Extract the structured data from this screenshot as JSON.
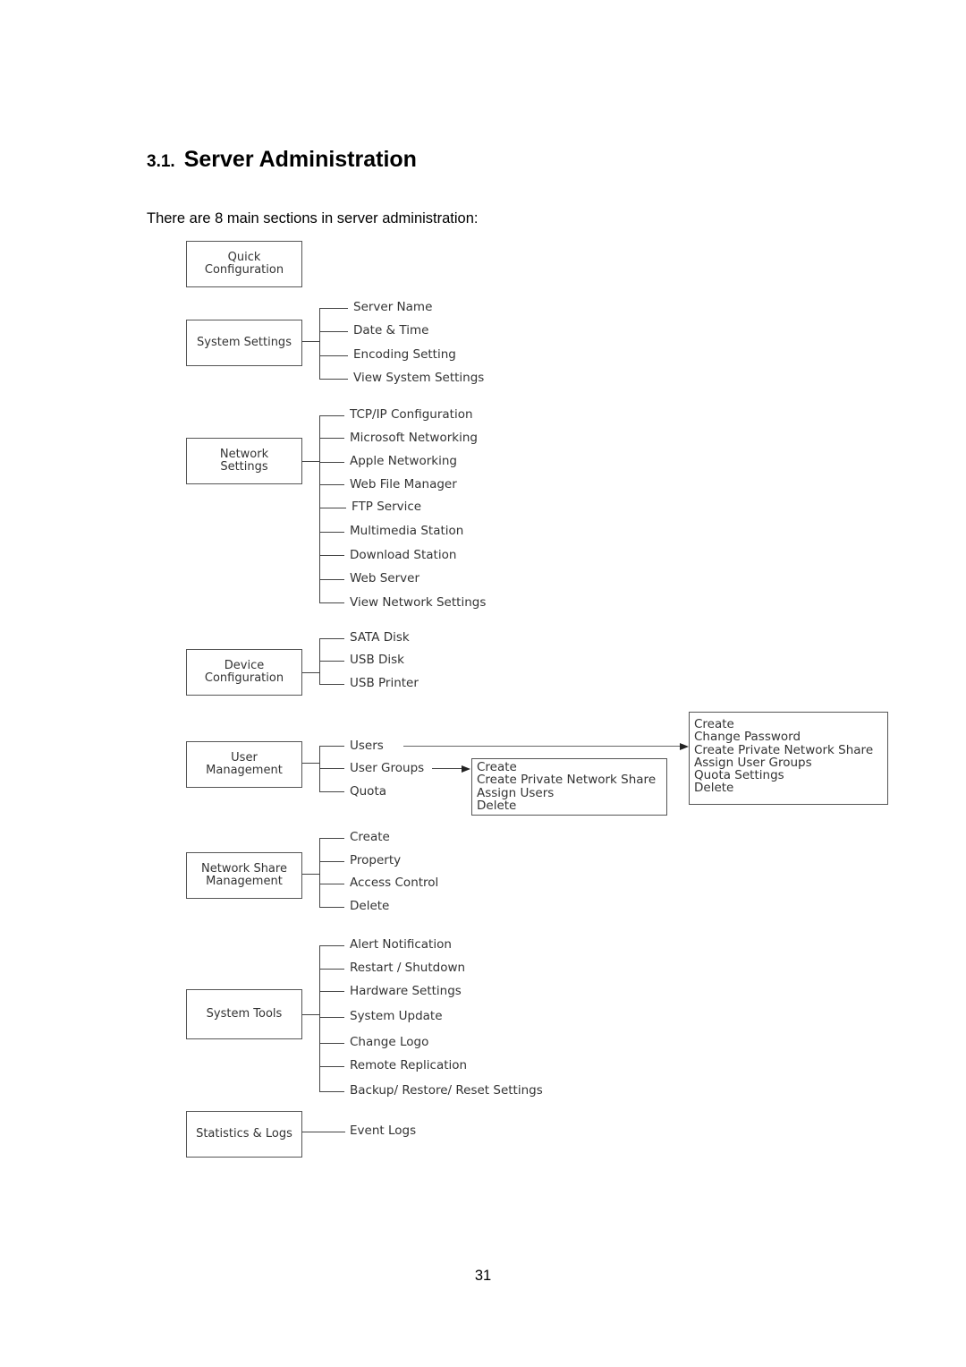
{
  "document": {
    "section_number": "3.1.",
    "section_title": "Server Administration",
    "intro_text": "There are 8 main sections in server administration:",
    "page_number": "31"
  },
  "diagram": {
    "sections": [
      {
        "label_lines": [
          "Quick",
          "Configuration"
        ],
        "items": []
      },
      {
        "label_lines": [
          "System Settings"
        ],
        "items": [
          "Server Name",
          "Date & Time",
          "Encoding Setting",
          "View System Settings"
        ]
      },
      {
        "label_lines": [
          "Network",
          "Settings"
        ],
        "items": [
          "TCP/IP Configuration",
          "Microsoft Networking",
          "Apple Networking",
          "Web File Manager",
          "FTP Service",
          "Multimedia Station",
          "Download Station",
          "Web Server",
          "View Network Settings"
        ]
      },
      {
        "label_lines": [
          "Device",
          "Configuration"
        ],
        "items": [
          "SATA Disk",
          "USB Disk",
          "USB Printer"
        ]
      },
      {
        "label_lines": [
          "User",
          "Management"
        ],
        "items": [
          "Users",
          "User Groups",
          "Quota"
        ]
      },
      {
        "label_lines": [
          "Network Share",
          "Management"
        ],
        "items": [
          "Create",
          "Property",
          "Access Control",
          "Delete"
        ]
      },
      {
        "label_lines": [
          "System Tools"
        ],
        "items": [
          "Alert Notification",
          "Restart / Shutdown",
          "Hardware Settings",
          "System Update",
          "Change Logo",
          "Remote Replication",
          "Backup/ Restore/ Reset Settings"
        ]
      },
      {
        "label_lines": [
          "Statistics & Logs"
        ],
        "items": [
          "Event Logs"
        ]
      }
    ],
    "users_actions": [
      "Create",
      "Change Password",
      "Create Private Network Share",
      "Assign User Groups",
      "Quota Settings",
      "Delete"
    ],
    "user_groups_actions": [
      "Create",
      "Create Private Network Share",
      "Assign Users",
      "Delete"
    ]
  }
}
